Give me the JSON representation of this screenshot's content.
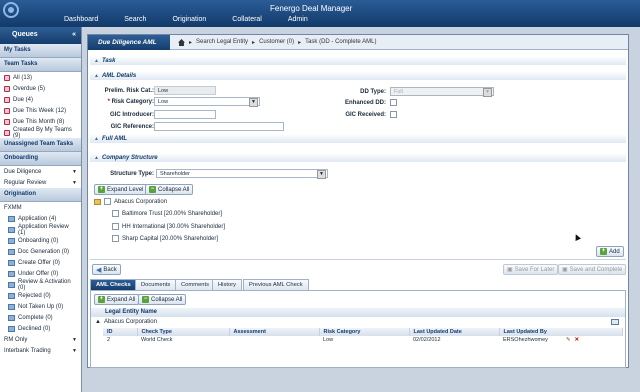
{
  "app": {
    "title": "Fenergo Deal Manager"
  },
  "nav": [
    "Dashboard",
    "Search",
    "Origination",
    "Collateral",
    "Admin"
  ],
  "sidebar": {
    "queues_label": "Queues",
    "my_tasks": "My Tasks",
    "team_tasks": "Team Tasks",
    "team_items": [
      "All (13)",
      "Overdue (5)",
      "Due (4)",
      "Due This Week (12)",
      "Due This Month (8)",
      "Created By My Teams (9)"
    ],
    "unassigned": "Unassigned Team Tasks",
    "onboarding": "Onboarding",
    "onboarding_items": [
      "Due Diligence",
      "Regular Review"
    ],
    "origination": "Origination",
    "fxmm": "FXMM",
    "fxmm_items": [
      "Application (4)",
      "Application Review (1)",
      "Onboarding (0)",
      "Doc Generation (0)",
      "Create Offer (0)",
      "Under Offer (0)",
      "Review & Activation (0)",
      "Rejected (0)",
      "Not Taken Up (0)",
      "Complete (0)",
      "Declined (0)"
    ],
    "rm_only": "RM Only",
    "interbank": "Interbank Trading"
  },
  "page": {
    "tab_title": "Due Diligence AML",
    "breadcrumb": [
      "Search Legal Entity",
      "Customer (0)",
      "Task (DD - Complete AML)"
    ]
  },
  "sections": {
    "task": "Task",
    "aml_details": "AML Details",
    "full_aml": "Full AML",
    "company_structure": "Company Structure"
  },
  "aml": {
    "prelim_label": "Prelim. Risk Cat.:",
    "prelim_value": "Low",
    "risk_label": "Risk Category:",
    "risk_value": "Low",
    "gic_intro_label": "GIC Introducer:",
    "gic_intro_value": "",
    "gic_ref_label": "GIC Reference:",
    "gic_ref_value": "",
    "dd_type_label": "DD Type:",
    "dd_type_value": "Full",
    "enhanced_label": "Enhanced DD:",
    "gic_received_label": "GIC Received:"
  },
  "structure": {
    "type_label": "Structure Type:",
    "type_value": "Shareholder",
    "expand_level": "Expand Level",
    "collapse_all": "Collapse All",
    "root": "Abacus Corporation",
    "children": [
      "Baltimore Trust [20.00% Shareholder]",
      "HH International [30.00% Shareholder]",
      "Sharp Capital [20.00% Shareholder]"
    ],
    "add": "Add"
  },
  "actions": {
    "back": "Back",
    "save_later": "Save For Later",
    "save_complete": "Save and Complete"
  },
  "tabs": [
    "AML Checks",
    "Documents",
    "Comments",
    "History",
    "Previous AML Check"
  ],
  "grid": {
    "expand_all": "Expand All",
    "collapse_all": "Collapse All",
    "group_header": "Legal Entity Name",
    "group_value": "Abacus Corporation",
    "columns": [
      "ID",
      "Check Type",
      "Assessment",
      "Risk Category",
      "Last Updated Date",
      "Last Updated By"
    ],
    "row": [
      "2",
      "World Check",
      "",
      "Low",
      "02/02/2012",
      "ERSOhezhwomey"
    ]
  }
}
